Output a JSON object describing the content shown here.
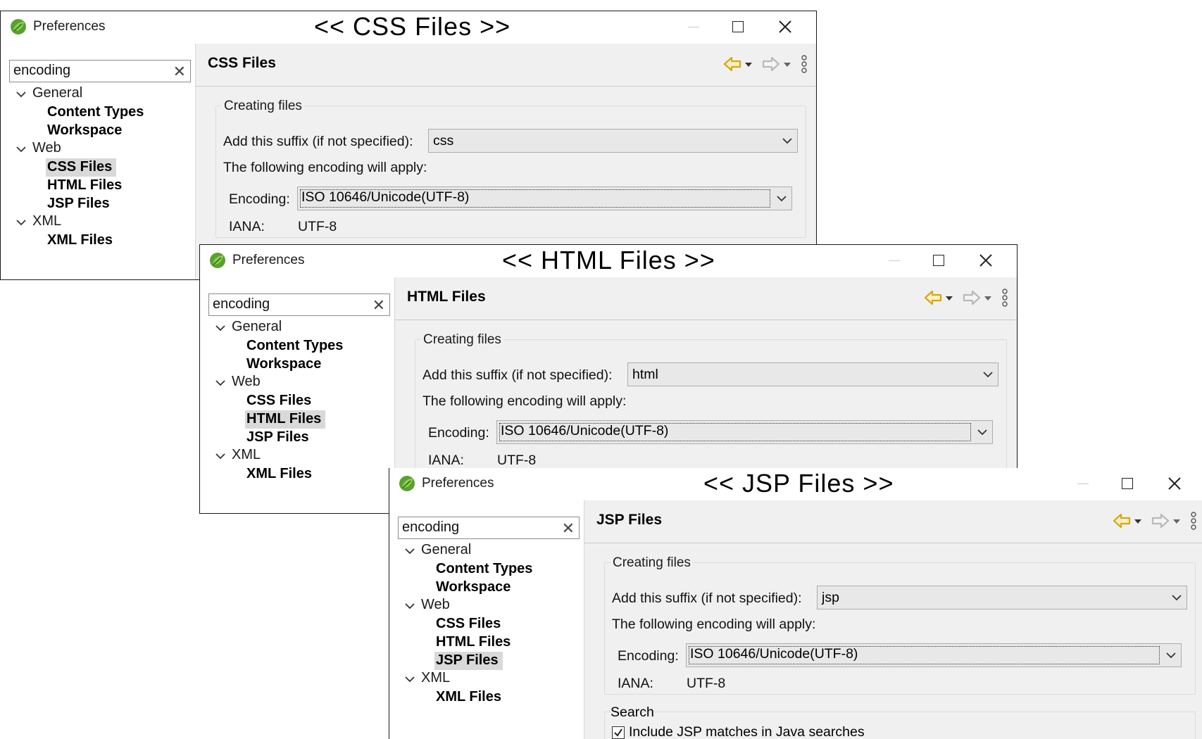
{
  "windows": [
    {
      "id": "css",
      "app_title": "Preferences",
      "caption": "<< CSS Files >>",
      "filter": {
        "value": "encoding",
        "clear_glyph": "✕"
      },
      "tree": [
        {
          "label": "General",
          "type": "group"
        },
        {
          "label": "Content Types",
          "type": "leaf"
        },
        {
          "label": "Workspace",
          "type": "leaf"
        },
        {
          "label": "Web",
          "type": "group"
        },
        {
          "label": "CSS Files",
          "type": "leaf",
          "selected": true
        },
        {
          "label": "HTML Files",
          "type": "leaf"
        },
        {
          "label": "JSP Files",
          "type": "leaf"
        },
        {
          "label": "XML",
          "type": "group"
        },
        {
          "label": "XML Files",
          "type": "leaf"
        }
      ],
      "page_title": "CSS Files",
      "section_title": "Creating files",
      "suffix_label": "Add this suffix (if not specified):",
      "suffix_value": "css",
      "encoding_intro": "The following encoding will apply:",
      "encoding_label": "Encoding:",
      "encoding_value": "ISO 10646/Unicode(UTF-8)",
      "iana_label": "IANA:",
      "iana_value": "UTF-8"
    },
    {
      "id": "html",
      "app_title": "Preferences",
      "caption": "<< HTML Files >>",
      "filter": {
        "value": "encoding",
        "clear_glyph": "✕"
      },
      "tree": [
        {
          "label": "General",
          "type": "group"
        },
        {
          "label": "Content Types",
          "type": "leaf"
        },
        {
          "label": "Workspace",
          "type": "leaf"
        },
        {
          "label": "Web",
          "type": "group"
        },
        {
          "label": "CSS Files",
          "type": "leaf"
        },
        {
          "label": "HTML Files",
          "type": "leaf",
          "selected": true
        },
        {
          "label": "JSP Files",
          "type": "leaf"
        },
        {
          "label": "XML",
          "type": "group"
        },
        {
          "label": "XML Files",
          "type": "leaf"
        }
      ],
      "page_title": "HTML Files",
      "section_title": "Creating files",
      "suffix_label": "Add this suffix (if not specified):",
      "suffix_value": "html",
      "encoding_intro": "The following encoding will apply:",
      "encoding_label": "Encoding:",
      "encoding_value": "ISO 10646/Unicode(UTF-8)",
      "iana_label": "IANA:",
      "iana_value": "UTF-8"
    },
    {
      "id": "jsp",
      "app_title": "Preferences",
      "caption": "<< JSP Files >>",
      "filter": {
        "value": "encoding",
        "clear_glyph": "✕"
      },
      "tree": [
        {
          "label": "General",
          "type": "group"
        },
        {
          "label": "Content Types",
          "type": "leaf"
        },
        {
          "label": "Workspace",
          "type": "leaf"
        },
        {
          "label": "Web",
          "type": "group"
        },
        {
          "label": "CSS Files",
          "type": "leaf"
        },
        {
          "label": "HTML Files",
          "type": "leaf"
        },
        {
          "label": "JSP Files",
          "type": "leaf",
          "selected": true
        },
        {
          "label": "XML",
          "type": "group"
        },
        {
          "label": "XML Files",
          "type": "leaf"
        }
      ],
      "page_title": "JSP Files",
      "section_title": "Creating files",
      "suffix_label": "Add this suffix (if not specified):",
      "suffix_value": "jsp",
      "encoding_intro": "The following encoding will apply:",
      "encoding_label": "Encoding:",
      "encoding_value": "ISO 10646/Unicode(UTF-8)",
      "iana_label": "IANA:",
      "iana_value": "UTF-8",
      "search_title": "Search",
      "search_checkbox_label": "Include JSP matches in Java searches",
      "search_checkbox_checked": true
    }
  ],
  "colors": {
    "back_arrow": "#d8a514",
    "forward_arrow": "#b8b8b8",
    "app_icon_green": "#5aa02c",
    "selection": "#d9d9d9"
  },
  "icons": [
    "app-leaf-icon",
    "clear-icon",
    "chevron-down-icon",
    "back-arrow-icon",
    "forward-arrow-icon",
    "dropdown-icon",
    "view-menu-icon",
    "minimize-icon",
    "maximize-icon",
    "close-icon",
    "checkbox-icon"
  ]
}
